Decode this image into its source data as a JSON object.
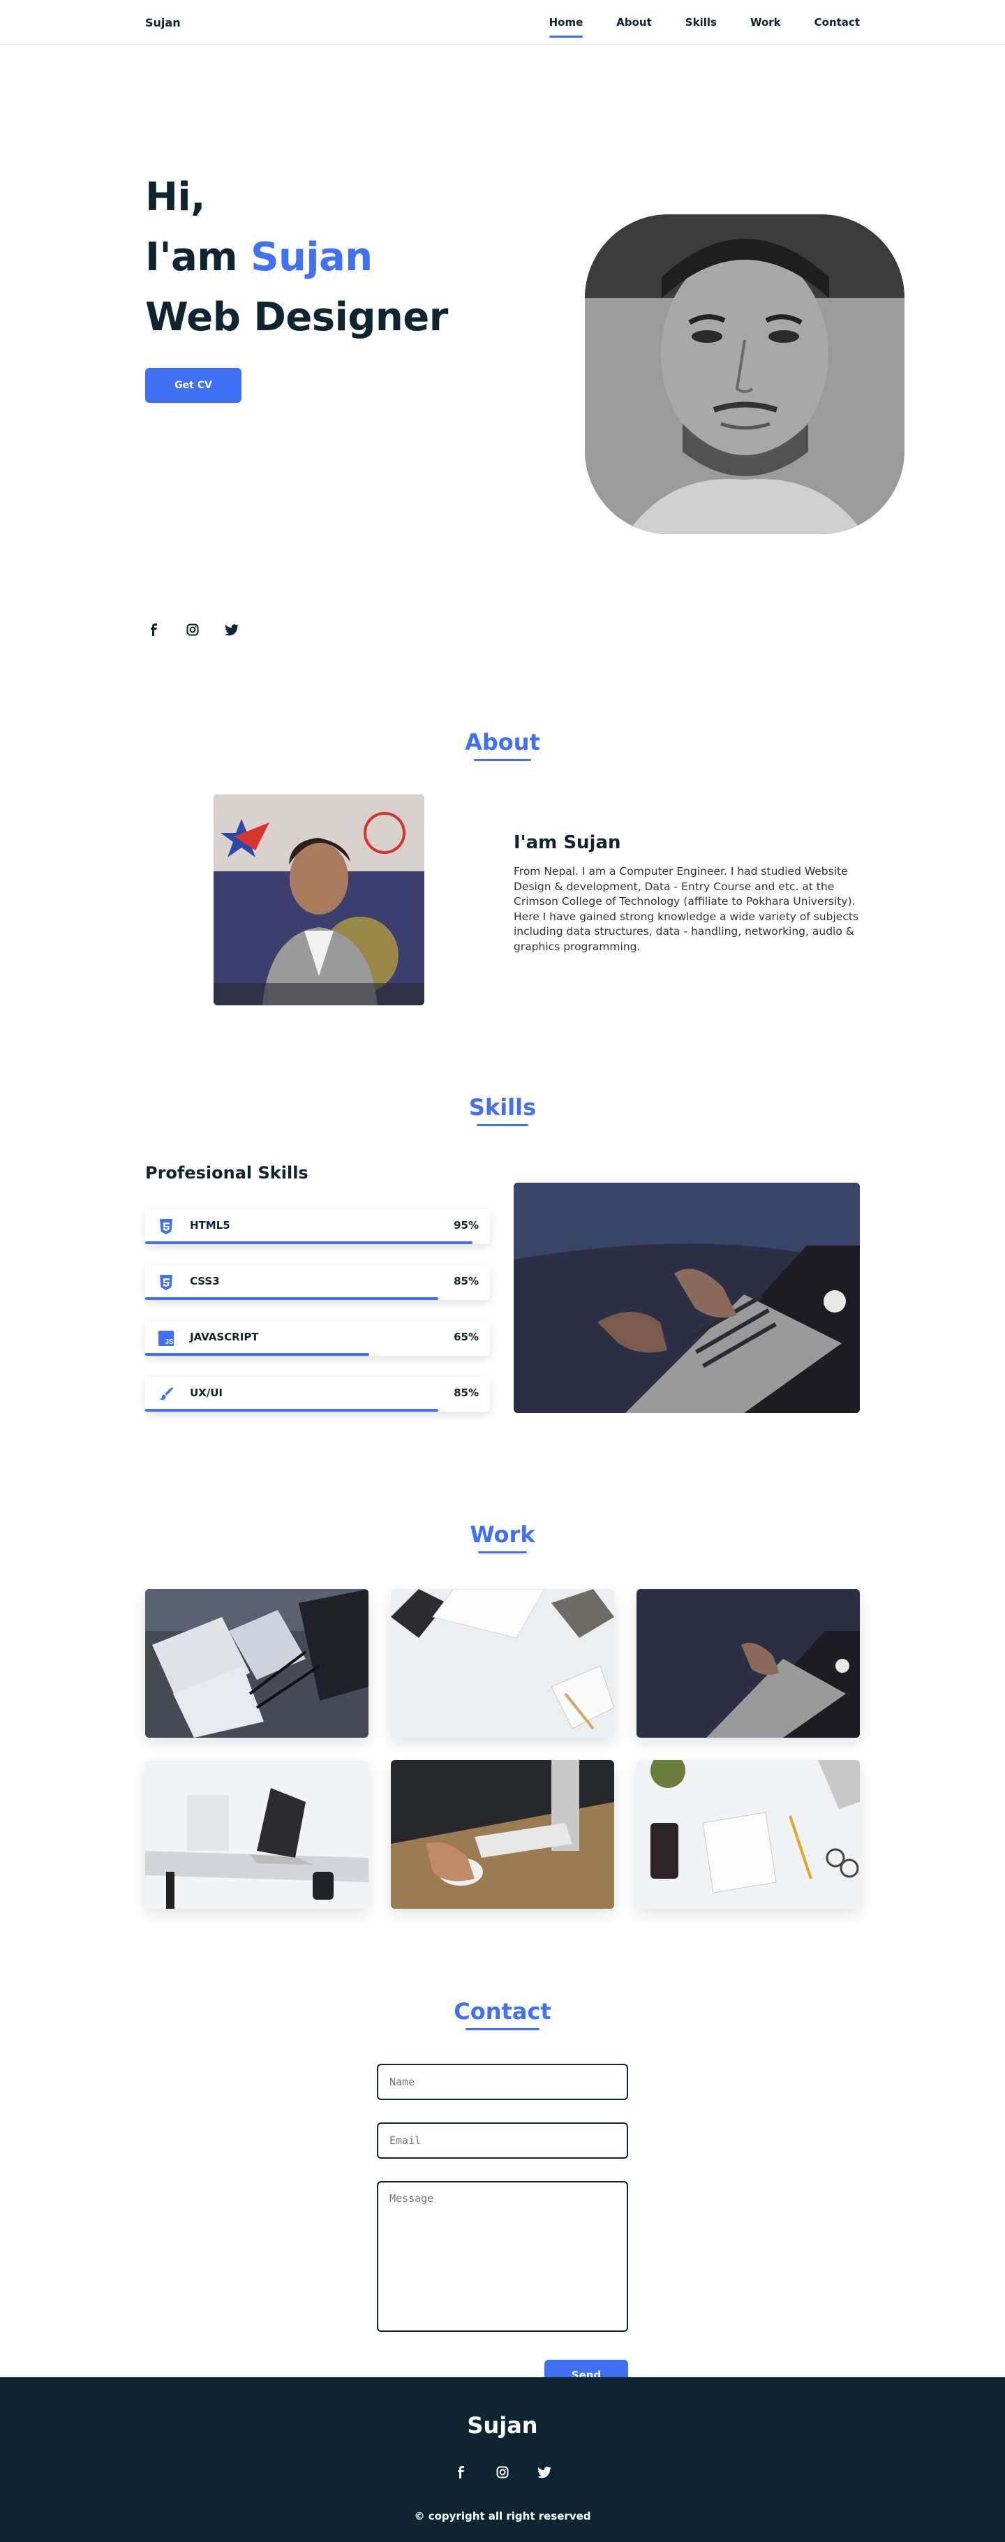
{
  "header": {
    "logo": "Sujan",
    "nav": [
      {
        "label": "Home",
        "active": true
      },
      {
        "label": "About",
        "active": false
      },
      {
        "label": "Skills",
        "active": false
      },
      {
        "label": "Work",
        "active": false
      },
      {
        "label": "Contact",
        "active": false
      }
    ]
  },
  "hero": {
    "line1": "Hi,",
    "line2_prefix": "I'am ",
    "line2_name": "Sujan",
    "line3": "Web Designer",
    "cta": "Get CV"
  },
  "socials": [
    "facebook-icon",
    "instagram-icon",
    "twitter-icon"
  ],
  "about": {
    "title": "About",
    "name": "I'am Sujan",
    "description": "From Nepal. I am a Computer Engineer. I had studied Website Design & development, Data - Entry Course and etc. at the Crimson College of Technology (affiliate to Pokhara University). Here I have gained strong knowledge a wide variety of subjects including data structures, data - handling, networking, audio & graphics programming."
  },
  "skills": {
    "title": "Skills",
    "subtitle": "Profesional Skills",
    "items": [
      {
        "name": "HTML5",
        "percent_label": "95%",
        "level": 0.95,
        "icon": "html5-icon"
      },
      {
        "name": "CSS3",
        "percent_label": "85%",
        "level": 0.85,
        "icon": "css3-icon"
      },
      {
        "name": "JAVASCRIPT",
        "percent_label": "65%",
        "level": 0.65,
        "icon": "javascript-icon"
      },
      {
        "name": "UX/UI",
        "percent_label": "85%",
        "level": 0.85,
        "icon": "brush-icon"
      }
    ]
  },
  "work": {
    "title": "Work"
  },
  "contact": {
    "title": "Contact",
    "name_placeholder": "Name",
    "email_placeholder": "Email",
    "message_placeholder": "Message",
    "send_label": "Send"
  },
  "footer": {
    "title": "Sujan",
    "copyright": "© copyright all right reserved"
  },
  "colors": {
    "accent": "#4070f4",
    "dark": "#0e2431"
  }
}
